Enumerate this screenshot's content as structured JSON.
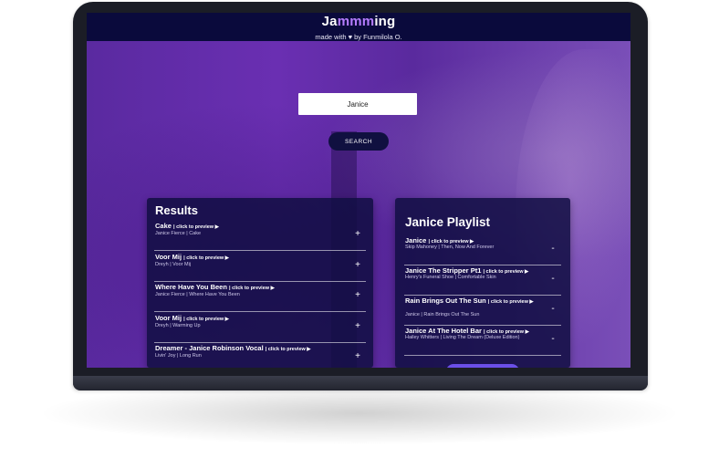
{
  "header": {
    "brand_prefix": "Ja",
    "brand_accent": "mmm",
    "brand_suffix": "ing",
    "made_with_prefix": "made with",
    "heart_icon": "heart-icon",
    "made_with_suffix": "by Funmilola O."
  },
  "search": {
    "value": "Janice",
    "button_label": "SEARCH"
  },
  "results": {
    "title": "Results",
    "preview_label": "| click to preview ▶",
    "add_symbol": "+",
    "tracks": [
      {
        "name": "Cake",
        "info": "Janice Fierce | Cake"
      },
      {
        "name": "Voor Mij",
        "info": "Dreyh | Voor Mij"
      },
      {
        "name": "Where Have You Been",
        "info": "Janice Fierce | Where Have You Been"
      },
      {
        "name": "Voor Mij",
        "info": "Dreyh | Warming Up"
      },
      {
        "name": "Dreamer - Janice Robinson Vocal",
        "info": "Livin' Joy | Long Run"
      }
    ]
  },
  "playlist": {
    "title": "Janice Playlist",
    "preview_label": "| click to preview ▶",
    "remove_symbol": "-",
    "tracks": [
      {
        "name": "Janice",
        "info": "Skip Mahoney | Then, Now And Forever"
      },
      {
        "name": "Janice The Stripper Pt1",
        "info": "Henry's Funeral Shoe | Comfortable Skin"
      },
      {
        "name": "Rain Brings Out The Sun",
        "info": "Janice | Rain Brings Out The Sun"
      },
      {
        "name": "Janice At The Hotel Bar",
        "info": "Hailey Whitters | Living The Dream (Deluxe Edition)"
      }
    ]
  },
  "colors": {
    "header_bg": "#0a0a3c",
    "brand_accent": "#b57cff",
    "panel_bg": "#100e42",
    "button_bg": "#101040",
    "save_button": "#6b4fe8"
  }
}
